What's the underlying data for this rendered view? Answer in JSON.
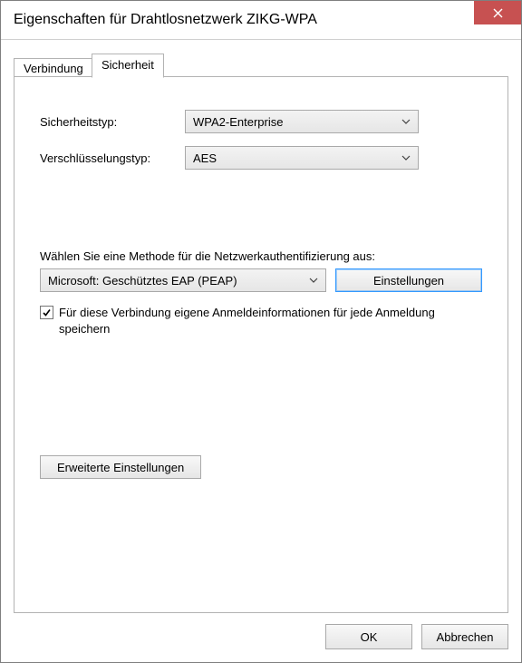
{
  "window": {
    "title": "Eigenschaften für Drahtlosnetzwerk ZIKG-WPA"
  },
  "tabs": {
    "connection": "Verbindung",
    "security": "Sicherheit"
  },
  "labels": {
    "security_type": "Sicherheitstyp:",
    "encryption_type": "Verschlüsselungstyp:",
    "auth_method": "Wählen Sie eine Methode für die Netzwerkauthentifizierung aus:",
    "remember_creds": "Für diese Verbindung eigene Anmeldeinformationen für jede Anmeldung speichern"
  },
  "values": {
    "security_type": "WPA2-Enterprise",
    "encryption_type": "AES",
    "auth_method": "Microsoft: Geschütztes EAP (PEAP)",
    "remember_creds_checked": true
  },
  "buttons": {
    "settings": "Einstellungen",
    "advanced": "Erweiterte Einstellungen",
    "ok": "OK",
    "cancel": "Abbrechen"
  }
}
